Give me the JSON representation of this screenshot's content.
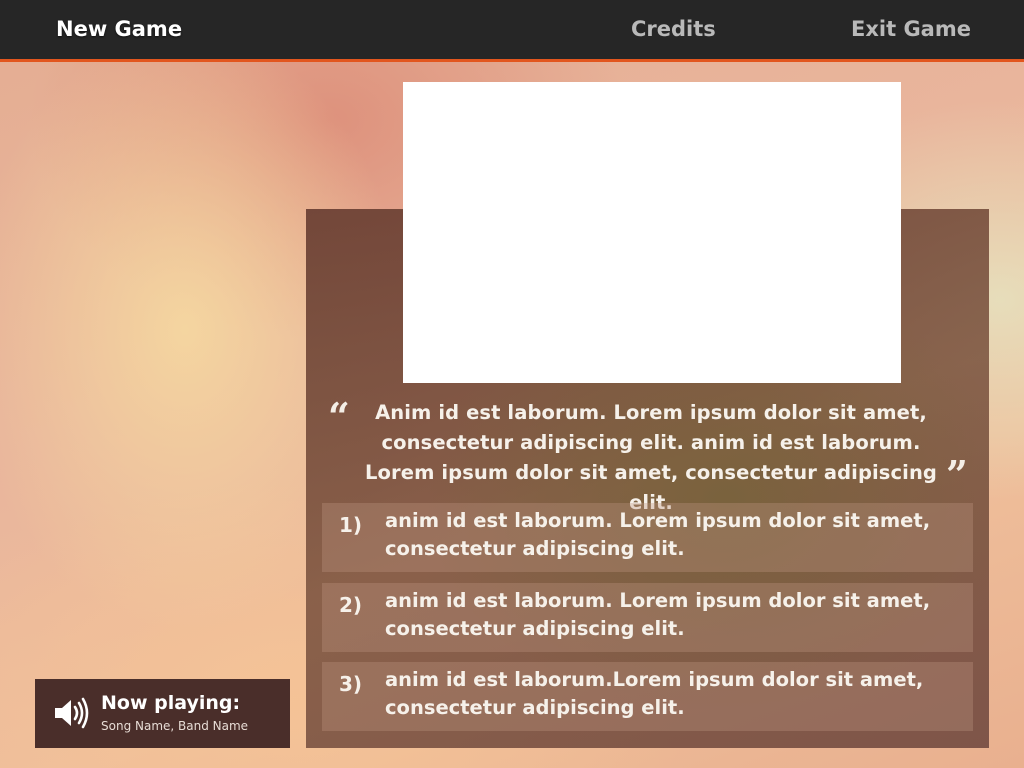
{
  "nav": {
    "new_game": "New Game",
    "credits": "Credits",
    "exit_game": "Exit Game"
  },
  "quote": {
    "open_mark": "“",
    "close_mark": "”",
    "text": "Anim id est laborum. Lorem ipsum dolor sit amet, consectetur adipiscing elit. anim id est laborum. Lorem ipsum dolor sit amet, consectetur adipiscing elit."
  },
  "answers": [
    {
      "number": "1)",
      "text": "anim id est laborum. Lorem ipsum dolor sit amet, consectetur adipiscing elit."
    },
    {
      "number": "2)",
      "text": "anim id est laborum. Lorem ipsum dolor sit amet, consectetur adipiscing elit."
    },
    {
      "number": "3)",
      "text": "anim id est laborum.Lorem ipsum dolor sit amet, consectetur adipiscing elit."
    }
  ],
  "now_playing": {
    "title": "Now playing:",
    "song": "Song Name, Band Name",
    "icon": "speaker-icon"
  },
  "colors": {
    "topbar": "#262626",
    "accent": "#e2561e",
    "panel": "#6e4a3e",
    "now_playing_bg": "#4a2e2a"
  }
}
